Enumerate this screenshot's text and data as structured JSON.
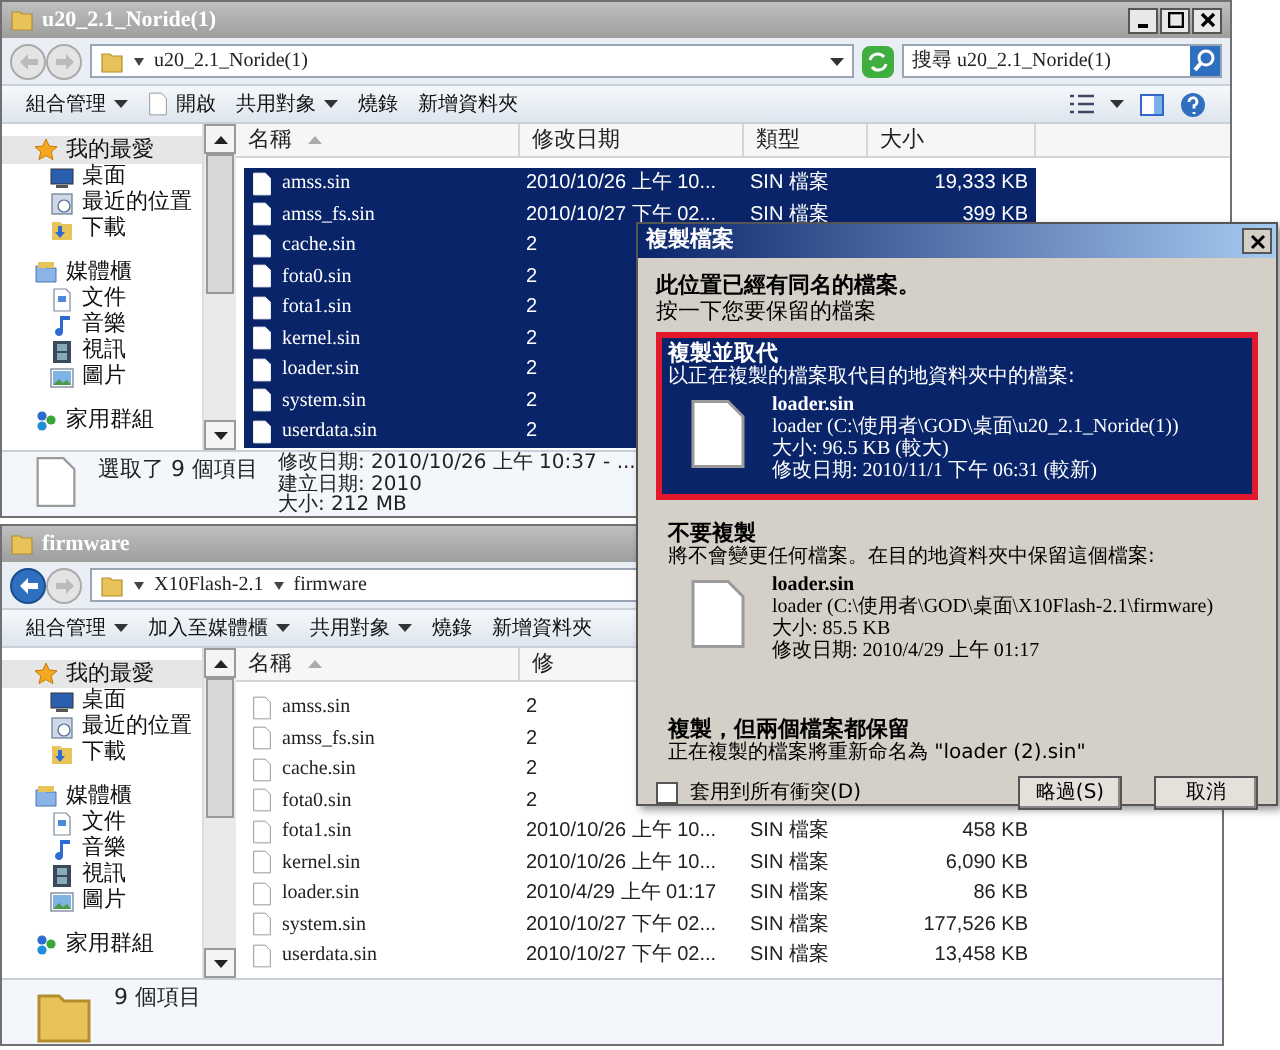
{
  "top_window": {
    "title": "u20_2.1_Noride(1)",
    "window_controls": true,
    "back_enabled": false,
    "address": [
      "u20_2.1_Noride(1)"
    ],
    "search": {
      "placeholder": "搜尋 u20_2.1_Noride(1)"
    },
    "toolbar": [
      {
        "label": "組合管理",
        "dropdown": true,
        "icon": false
      },
      {
        "label": "開啟",
        "dropdown": false,
        "icon": true
      },
      {
        "label": "共用對象",
        "dropdown": true,
        "icon": false
      },
      {
        "label": "燒錄",
        "dropdown": false,
        "icon": false
      },
      {
        "label": "新增資料夾",
        "dropdown": false,
        "icon": false
      }
    ],
    "view_tools": true,
    "sidebar": [
      {
        "label": "我的最愛",
        "kind": "star",
        "selected": true,
        "children": [
          {
            "label": "桌面",
            "kind": "desktop",
            "selected": false
          },
          {
            "label": "最近的位置",
            "kind": "recent",
            "selected": false
          },
          {
            "label": "下載",
            "kind": "download",
            "selected": false
          }
        ]
      },
      {
        "label": "媒體櫃",
        "kind": "library",
        "selected": false,
        "children": [
          {
            "label": "文件",
            "kind": "document",
            "selected": false
          },
          {
            "label": "音樂",
            "kind": "music",
            "selected": false
          },
          {
            "label": "視訊",
            "kind": "video",
            "selected": false
          },
          {
            "label": "圖片",
            "kind": "picture",
            "selected": false
          }
        ]
      },
      {
        "label": "家用群組",
        "kind": "homegroup",
        "selected": false
      }
    ],
    "columns": [
      {
        "label": "名稱",
        "sorted": true
      },
      {
        "label": "修改日期",
        "sorted": false
      },
      {
        "label": "類型",
        "sorted": false
      },
      {
        "label": "大小",
        "sorted": false
      }
    ],
    "rows": [
      {
        "name": "amss.sin",
        "date": "2010/10/26 上午 10...",
        "type": "SIN 檔案",
        "size": "19,333 KB",
        "selected": true
      },
      {
        "name": "amss_fs.sin",
        "date": "2010/10/27 下午 02...",
        "type": "SIN 檔案",
        "size": "399 KB",
        "selected": true
      },
      {
        "name": "cache.sin",
        "date": "2",
        "selected": true
      },
      {
        "name": "fota0.sin",
        "date": "2",
        "selected": true
      },
      {
        "name": "fota1.sin",
        "date": "2",
        "selected": true
      },
      {
        "name": "kernel.sin",
        "date": "2",
        "selected": true
      },
      {
        "name": "loader.sin",
        "date": "2",
        "selected": true
      },
      {
        "name": "system.sin",
        "date": "2",
        "selected": true
      },
      {
        "name": "userdata.sin",
        "date": "2",
        "selected": true
      }
    ],
    "status": {
      "kind": "file",
      "summary": "選取了 9 個項目",
      "details": [
        "修改日期: 2010/10/26 上午 10:37 - ...",
        "建立日期: 2010",
        "大小: 212 MB"
      ]
    }
  },
  "bottom_window": {
    "title": "firmware",
    "window_controls": false,
    "back_enabled": true,
    "address": [
      "X10Flash-2.1",
      "firmware"
    ],
    "toolbar": [
      {
        "label": "組合管理",
        "dropdown": true,
        "icon": false
      },
      {
        "label": "加入至媒體櫃",
        "dropdown": true,
        "icon": false
      },
      {
        "label": "共用對象",
        "dropdown": true,
        "icon": false
      },
      {
        "label": "燒錄",
        "dropdown": false,
        "icon": false
      },
      {
        "label": "新增資料夾",
        "dropdown": false,
        "icon": false
      }
    ],
    "sidebar": [
      {
        "label": "我的最愛",
        "kind": "star",
        "selected": true,
        "children": [
          {
            "label": "桌面",
            "kind": "desktop",
            "selected": false
          },
          {
            "label": "最近的位置",
            "kind": "recent",
            "selected": false
          },
          {
            "label": "下載",
            "kind": "download",
            "selected": false
          }
        ]
      },
      {
        "label": "媒體櫃",
        "kind": "library",
        "selected": false,
        "children": [
          {
            "label": "文件",
            "kind": "document",
            "selected": false
          },
          {
            "label": "音樂",
            "kind": "music",
            "selected": false
          },
          {
            "label": "視訊",
            "kind": "video",
            "selected": false
          },
          {
            "label": "圖片",
            "kind": "picture",
            "selected": false
          }
        ]
      },
      {
        "label": "家用群組",
        "kind": "homegroup",
        "selected": false
      }
    ],
    "columns": [
      {
        "label": "名稱",
        "sorted": true
      },
      {
        "label": "修",
        "sorted": false
      }
    ],
    "rows": [
      {
        "name": "amss.sin",
        "date": "2",
        "selected": false
      },
      {
        "name": "amss_fs.sin",
        "date": "2",
        "selected": false
      },
      {
        "name": "cache.sin",
        "date": "2",
        "selected": false
      },
      {
        "name": "fota0.sin",
        "date": "2",
        "selected": false
      },
      {
        "name": "fota1.sin",
        "date": "2010/10/26 上午 10...",
        "type": "SIN 檔案",
        "size": "458 KB",
        "selected": false
      },
      {
        "name": "kernel.sin",
        "date": "2010/10/26 上午 10...",
        "type": "SIN 檔案",
        "size": "6,090 KB",
        "selected": false
      },
      {
        "name": "loader.sin",
        "date": "2010/4/29 上午 01:17",
        "type": "SIN 檔案",
        "size": "86 KB",
        "selected": false
      },
      {
        "name": "system.sin",
        "date": "2010/10/27 下午 02...",
        "type": "SIN 檔案",
        "size": "177,526 KB",
        "selected": false
      },
      {
        "name": "userdata.sin",
        "date": "2010/10/27 下午 02...",
        "type": "SIN 檔案",
        "size": "13,458 KB",
        "selected": false
      }
    ],
    "status": {
      "kind": "folder",
      "summary": "9 個項目"
    }
  },
  "dialog": {
    "title": "複製檔案",
    "heading": "此位置已經有同名的檔案。",
    "subheading": "按一下您要保留的檔案",
    "options": [
      {
        "kind": "file",
        "selected": true,
        "title": "複製並取代",
        "description": "以正在複製的檔案取代目的地資料夾中的檔案:",
        "file": {
          "name": "loader.sin",
          "path": "loader (C:\\使用者\\GOD\\桌面\\u20_2.1_Noride(1))",
          "size": "大小: 96.5 KB (較大)",
          "date": "修改日期: 2010/11/1 下午 06:31 (較新)"
        }
      },
      {
        "kind": "file",
        "selected": false,
        "title": "不要複製",
        "description": "將不會變更任何檔案。在目的地資料夾中保留這個檔案:",
        "file": {
          "name": "loader.sin",
          "path": "loader (C:\\使用者\\GOD\\桌面\\X10Flash-2.1\\firmware)",
          "size": "大小: 85.5 KB",
          "date": "修改日期: 2010/4/29 上午 01:17"
        }
      },
      {
        "kind": "text",
        "selected": false,
        "title": "複製，但兩個檔案都保留",
        "description": "正在複製的檔案將重新命名為 \"loader (2).sin\""
      }
    ],
    "apply_all": {
      "label": "套用到所有衝突(D)",
      "checked": false
    },
    "buttons": [
      "略過(S)",
      "取消"
    ]
  }
}
